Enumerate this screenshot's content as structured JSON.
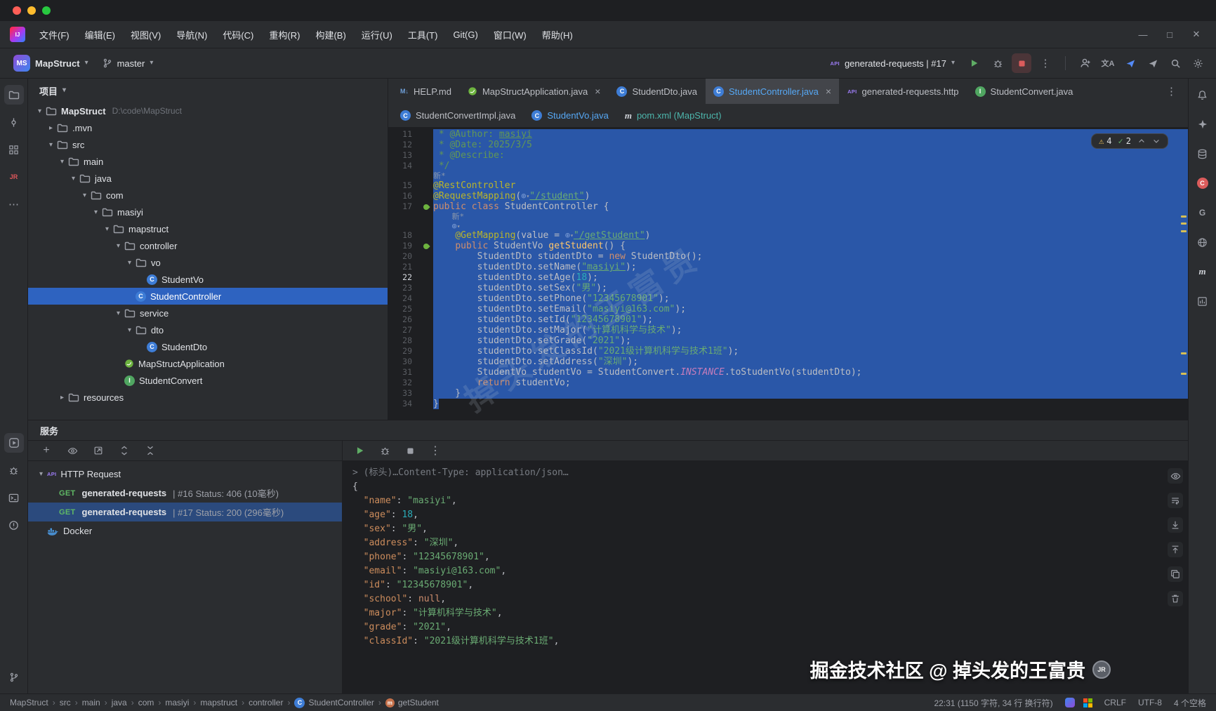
{
  "window_controls": [
    "minimize",
    "maximize",
    "close"
  ],
  "menu": {
    "items": [
      "文件(F)",
      "编辑(E)",
      "视图(V)",
      "导航(N)",
      "代码(C)",
      "重构(R)",
      "构建(B)",
      "运行(U)",
      "工具(T)",
      "Git(G)",
      "窗口(W)",
      "帮助(H)"
    ]
  },
  "toolbar": {
    "project_badge": "MS",
    "project_name": "MapStruct",
    "branch": "master",
    "run_config": "generated-requests | #17",
    "right_icons": [
      {
        "icon": "add-user",
        "name": "code-with-me"
      },
      {
        "icon": "translate",
        "name": "translate"
      },
      {
        "icon": "send-blue",
        "name": "send-plugin"
      },
      {
        "icon": "send-gray",
        "name": "send-plugin-2"
      },
      {
        "icon": "search",
        "name": "search-everywhere"
      },
      {
        "icon": "settings",
        "name": "settings"
      }
    ]
  },
  "left_strip": {
    "top": [
      {
        "icon": "folder",
        "name": "project-toolwindow",
        "active": true
      },
      {
        "icon": "commit",
        "name": "commit-toolwindow"
      },
      {
        "icon": "structure",
        "name": "structure-toolwindow"
      },
      {
        "icon": "jrebel",
        "name": "jrebel-toolwindow"
      },
      {
        "icon": "more-h",
        "name": "more-toolwindows"
      }
    ],
    "bottom": [
      {
        "icon": "services",
        "name": "services-toolwindow",
        "active": true
      },
      {
        "icon": "bug",
        "name": "debug-toolwindow"
      },
      {
        "icon": "terminal",
        "name": "terminal-toolwindow"
      },
      {
        "icon": "problems",
        "name": "problems-toolwindow"
      }
    ],
    "pinned": [
      {
        "icon": "branch",
        "name": "version-control-toolwindow"
      }
    ]
  },
  "right_strip": [
    {
      "icon": "bell",
      "name": "notifications"
    },
    {
      "icon": "ai",
      "name": "ai-assistant"
    },
    {
      "icon": "database",
      "name": "database-toolwindow"
    },
    {
      "icon": "redc",
      "name": "c-plugin-toolwindow"
    },
    {
      "icon": "gradle",
      "name": "gradle-toolwindow"
    },
    {
      "icon": "globe",
      "name": "endpoints-toolwindow"
    },
    {
      "icon": "maven",
      "name": "maven-toolwindow"
    },
    {
      "icon": "deps",
      "name": "dependencies-toolwindow"
    }
  ],
  "project_panel": {
    "title": "项目",
    "tree": [
      {
        "label": "MapStruct",
        "suffix": "D:\\code\\MapStruct",
        "depth": 0,
        "icon": "folder",
        "chev": "open",
        "bold": true
      },
      {
        "label": ".mvn",
        "depth": 1,
        "icon": "folder",
        "chev": "closed"
      },
      {
        "label": "src",
        "depth": 1,
        "icon": "folder",
        "chev": "open"
      },
      {
        "label": "main",
        "depth": 2,
        "icon": "folder",
        "chev": "open"
      },
      {
        "label": "java",
        "depth": 3,
        "icon": "folder",
        "chev": "open"
      },
      {
        "label": "com",
        "depth": 4,
        "icon": "folder",
        "chev": "open"
      },
      {
        "label": "masiyi",
        "depth": 5,
        "icon": "folder",
        "chev": "open"
      },
      {
        "label": "mapstruct",
        "depth": 6,
        "icon": "folder",
        "chev": "open"
      },
      {
        "label": "controller",
        "depth": 7,
        "icon": "folder",
        "chev": "open"
      },
      {
        "label": "vo",
        "depth": 8,
        "icon": "folder",
        "chev": "open"
      },
      {
        "label": "StudentVo",
        "depth": 9,
        "icon": "class"
      },
      {
        "label": "StudentController",
        "depth": 8,
        "icon": "class",
        "selected": true
      },
      {
        "label": "service",
        "depth": 7,
        "icon": "folder",
        "chev": "open"
      },
      {
        "label": "dto",
        "depth": 8,
        "icon": "folder",
        "chev": "open"
      },
      {
        "label": "StudentDto",
        "depth": 9,
        "icon": "class"
      },
      {
        "label": "MapStructApplication",
        "depth": 7,
        "icon": "spring"
      },
      {
        "label": "StudentConvert",
        "depth": 7,
        "icon": "interface"
      },
      {
        "label": "resources",
        "depth": 2,
        "icon": "folder",
        "chev": "closed"
      }
    ]
  },
  "tabs": {
    "row1": [
      {
        "label": "HELP.md",
        "icon": "md"
      },
      {
        "label": "MapStructApplication.java",
        "icon": "spring",
        "close": true
      },
      {
        "label": "StudentDto.java",
        "icon": "class"
      },
      {
        "label": "StudentController.java",
        "icon": "class",
        "active": true,
        "close": true,
        "color": "blue"
      },
      {
        "label": "generated-requests.http",
        "icon": "api"
      },
      {
        "label": "StudentConvert.java",
        "icon": "interface"
      }
    ],
    "row2": [
      {
        "label": "StudentConvertImpl.java",
        "icon": "class"
      },
      {
        "label": "StudentVo.java",
        "icon": "class",
        "color": "blue"
      },
      {
        "label": "pom.xml (MapStruct)",
        "icon": "maven",
        "color": "teal"
      }
    ]
  },
  "editor": {
    "inspection": {
      "warnings": "4",
      "ok": "2"
    },
    "watermark": "掉头发的王富贵",
    "scroll_marks": [
      30,
      32.5,
      35,
      77,
      84
    ],
    "rows": [
      {
        "n": "11",
        "s": 1,
        "seg": [
          [
            "doc",
            " * @Author: "
          ],
          [
            "doclink",
            "masiyi"
          ]
        ]
      },
      {
        "n": "12",
        "s": 1,
        "seg": [
          [
            "doc",
            " * @Date: 2025/3/5"
          ]
        ]
      },
      {
        "n": "13",
        "s": 1,
        "seg": [
          [
            "doc",
            " * @Describe:"
          ]
        ]
      },
      {
        "n": "14",
        "s": 1,
        "seg": [
          [
            "doc",
            " */"
          ]
        ]
      },
      {
        "mini": 1,
        "s": 1,
        "seg": [
          [
            "inlay",
            "新*"
          ]
        ]
      },
      {
        "n": "15",
        "s": 1,
        "seg": [
          [
            "ann",
            "@RestController"
          ]
        ]
      },
      {
        "n": "16",
        "s": 1,
        "seg": [
          [
            "ann",
            "@RequestMapping"
          ],
          [
            "plain",
            "("
          ],
          [
            "@gmini"
          ],
          [
            "strlink",
            "\"/student\""
          ],
          [
            "plain",
            ")"
          ]
        ]
      },
      {
        "n": "17",
        "s": 1,
        "g": "bean",
        "seg": [
          [
            "kw",
            "public class "
          ],
          [
            "plain",
            "StudentController {"
          ]
        ]
      },
      {
        "mini": 1,
        "s": 1,
        "seg": [
          [
            "plain",
            "    "
          ],
          [
            "inlay",
            "新*"
          ]
        ]
      },
      {
        "mini": 1,
        "s": 1,
        "seg": [
          [
            "plain",
            "    "
          ],
          [
            "@gmini"
          ]
        ]
      },
      {
        "n": "18",
        "s": 1,
        "seg": [
          [
            "plain",
            "    "
          ],
          [
            "ann",
            "@GetMapping"
          ],
          [
            "plain",
            "(value = "
          ],
          [
            "@gmini"
          ],
          [
            "strlink",
            "\"/getStudent\""
          ],
          [
            "plain",
            ")"
          ]
        ]
      },
      {
        "n": "19",
        "s": 1,
        "g": "bean",
        "seg": [
          [
            "plain",
            "    "
          ],
          [
            "kw",
            "public "
          ],
          [
            "plain",
            "StudentVo "
          ],
          [
            "mth",
            "getStudent"
          ],
          [
            "plain",
            "() {"
          ]
        ]
      },
      {
        "n": "20",
        "s": 1,
        "seg": [
          [
            "plain",
            "        StudentDto studentDto = "
          ],
          [
            "kw",
            "new"
          ],
          [
            "plain",
            " StudentDto();"
          ]
        ]
      },
      {
        "n": "21",
        "s": 1,
        "seg": [
          [
            "plain",
            "        studentDto.setName("
          ],
          [
            "strlink",
            "\"masiyi\""
          ],
          [
            "plain",
            ");"
          ]
        ]
      },
      {
        "n": "22",
        "s": 1,
        "cur": 1,
        "seg": [
          [
            "plain",
            "        studentDto.setAge("
          ],
          [
            "num",
            "18"
          ],
          [
            "plain",
            ");"
          ]
        ]
      },
      {
        "n": "23",
        "s": 1,
        "seg": [
          [
            "plain",
            "        studentDto.setSex("
          ],
          [
            "str",
            "\"男\""
          ],
          [
            "plain",
            ");"
          ]
        ]
      },
      {
        "n": "24",
        "s": 1,
        "seg": [
          [
            "plain",
            "        studentDto.setPhone("
          ],
          [
            "str",
            "\"12345678901\""
          ],
          [
            "plain",
            ");"
          ]
        ]
      },
      {
        "n": "25",
        "s": 1,
        "seg": [
          [
            "plain",
            "        studentDto.setEmail("
          ],
          [
            "str",
            "\"masiyi@163.com\""
          ],
          [
            "plain",
            ");"
          ]
        ]
      },
      {
        "n": "26",
        "s": 1,
        "seg": [
          [
            "plain",
            "        studentDto.setId("
          ],
          [
            "str",
            "\"12345678901\""
          ],
          [
            "plain",
            ");"
          ]
        ]
      },
      {
        "n": "27",
        "s": 1,
        "seg": [
          [
            "plain",
            "        studentDto.setMajor("
          ],
          [
            "str",
            "\"计算机科学与技术\""
          ],
          [
            "plain",
            ");"
          ]
        ]
      },
      {
        "n": "28",
        "s": 1,
        "seg": [
          [
            "plain",
            "        studentDto.setGrade("
          ],
          [
            "str",
            "\"2021\""
          ],
          [
            "plain",
            ");"
          ]
        ]
      },
      {
        "n": "29",
        "s": 1,
        "seg": [
          [
            "plain",
            "        studentDto.setClassId("
          ],
          [
            "str",
            "\"2021级计算机科学与技术1班\""
          ],
          [
            "plain",
            ");"
          ]
        ]
      },
      {
        "n": "30",
        "s": 1,
        "seg": [
          [
            "plain",
            "        studentDto.setAddress("
          ],
          [
            "str",
            "\"深圳\""
          ],
          [
            "plain",
            ");"
          ]
        ]
      },
      {
        "n": "31",
        "s": 1,
        "seg": [
          [
            "plain",
            "        StudentVo studentVo = StudentConvert."
          ],
          [
            "static",
            "INSTANCE"
          ],
          [
            "plain",
            ".toStudentVo(studentDto);"
          ]
        ]
      },
      {
        "n": "32",
        "s": 1,
        "seg": [
          [
            "plain",
            "        "
          ],
          [
            "kw",
            "return"
          ],
          [
            "plain",
            " studentVo;"
          ]
        ]
      },
      {
        "n": "33",
        "s": 1,
        "seg": [
          [
            "plain",
            "    }"
          ]
        ]
      },
      {
        "n": "34",
        "s": "char",
        "seg": [
          [
            "plain",
            "}"
          ]
        ]
      }
    ]
  },
  "services": {
    "header": "服务",
    "toolbar": [
      {
        "icon": "add",
        "name": "add-service"
      },
      {
        "icon": "eye",
        "name": "show-options"
      },
      {
        "icon": "open-new",
        "name": "open-in-editor"
      },
      {
        "icon": "expand-all",
        "name": "expand-all"
      },
      {
        "icon": "collapse-all",
        "name": "collapse-all"
      }
    ],
    "tree": [
      {
        "type": "group",
        "label": "HTTP Request",
        "icon": "api",
        "chev": "open"
      },
      {
        "type": "req",
        "badge": "GET",
        "name": "generated-requests",
        "meta": "| #16 Status: 406 (10毫秒)"
      },
      {
        "type": "req",
        "badge": "GET",
        "name": "generated-requests",
        "meta": "| #17 Status: 200 (296毫秒)",
        "selected": true
      },
      {
        "type": "group",
        "label": "Docker",
        "icon": "docker"
      }
    ]
  },
  "console": {
    "toolbar": [
      {
        "icon": "play",
        "name": "rerun-request"
      },
      {
        "icon": "bug",
        "name": "debug-request"
      },
      {
        "icon": "stop-gray",
        "name": "stop-process"
      },
      {
        "icon": "more-v",
        "name": "more-options"
      }
    ],
    "side": [
      {
        "icon": "eye",
        "name": "preview-options"
      },
      {
        "icon": "soft-wrap",
        "name": "soft-wrap"
      },
      {
        "icon": "scroll-down",
        "name": "scroll-to-end"
      },
      {
        "icon": "scroll-up",
        "name": "scroll-to-top"
      },
      {
        "icon": "copy",
        "name": "copy-output"
      },
      {
        "icon": "clear",
        "name": "clear-output"
      }
    ],
    "lines": [
      [
        [
          "g",
          "> (标头)…Content-Type: application/json…"
        ]
      ],
      [
        [
          "p",
          "{"
        ]
      ],
      [
        [
          "p",
          "  "
        ],
        [
          "k",
          "\"name\""
        ],
        [
          "p",
          ": "
        ],
        [
          "s",
          "\"masiyi\""
        ],
        [
          "p",
          ","
        ]
      ],
      [
        [
          "p",
          "  "
        ],
        [
          "k",
          "\"age\""
        ],
        [
          "p",
          ": "
        ],
        [
          "n",
          "18"
        ],
        [
          "p",
          ","
        ]
      ],
      [
        [
          "p",
          "  "
        ],
        [
          "k",
          "\"sex\""
        ],
        [
          "p",
          ": "
        ],
        [
          "s",
          "\"男\""
        ],
        [
          "p",
          ","
        ]
      ],
      [
        [
          "p",
          "  "
        ],
        [
          "k",
          "\"address\""
        ],
        [
          "p",
          ": "
        ],
        [
          "s",
          "\"深圳\""
        ],
        [
          "p",
          ","
        ]
      ],
      [
        [
          "p",
          "  "
        ],
        [
          "k",
          "\"phone\""
        ],
        [
          "p",
          ": "
        ],
        [
          "s",
          "\"12345678901\""
        ],
        [
          "p",
          ","
        ]
      ],
      [
        [
          "p",
          "  "
        ],
        [
          "k",
          "\"email\""
        ],
        [
          "p",
          ": "
        ],
        [
          "s",
          "\"masiyi@163.com\""
        ],
        [
          "p",
          ","
        ]
      ],
      [
        [
          "p",
          "  "
        ],
        [
          "k",
          "\"id\""
        ],
        [
          "p",
          ": "
        ],
        [
          "s",
          "\"12345678901\""
        ],
        [
          "p",
          ","
        ]
      ],
      [
        [
          "p",
          "  "
        ],
        [
          "k",
          "\"school\""
        ],
        [
          "p",
          ": "
        ],
        [
          "nul",
          "null"
        ],
        [
          "p",
          ","
        ]
      ],
      [
        [
          "p",
          "  "
        ],
        [
          "k",
          "\"major\""
        ],
        [
          "p",
          ": "
        ],
        [
          "s",
          "\"计算机科学与技术\""
        ],
        [
          "p",
          ","
        ]
      ],
      [
        [
          "p",
          "  "
        ],
        [
          "k",
          "\"grade\""
        ],
        [
          "p",
          ": "
        ],
        [
          "s",
          "\"2021\""
        ],
        [
          "p",
          ","
        ]
      ],
      [
        [
          "p",
          "  "
        ],
        [
          "k",
          "\"classId\""
        ],
        [
          "p",
          ": "
        ],
        [
          "s",
          "\"2021级计算机科学与技术1班\""
        ],
        [
          "p",
          ","
        ]
      ]
    ]
  },
  "status_bar": {
    "breadcrumbs": [
      {
        "label": "MapStruct"
      },
      {
        "label": "src"
      },
      {
        "label": "main"
      },
      {
        "label": "java"
      },
      {
        "label": "com"
      },
      {
        "label": "masiyi"
      },
      {
        "label": "mapstruct"
      },
      {
        "label": "controller"
      },
      {
        "label": "StudentController",
        "icon": "class"
      },
      {
        "label": "getStudent",
        "icon": "method"
      }
    ],
    "right_text": "22:31 (1150 字符, 34 行 换行符)",
    "icons": [
      {
        "icon": "bluep",
        "name": "plugin-status"
      },
      {
        "icon": "win",
        "name": "translation-plugin"
      }
    ],
    "crlf": "CRLF",
    "encoding": "UTF-8",
    "indent": "4 个空格"
  },
  "footer_watermark": {
    "text": "掘金技术社区 @ 掉头发的王富贵",
    "badge": "JR"
  }
}
